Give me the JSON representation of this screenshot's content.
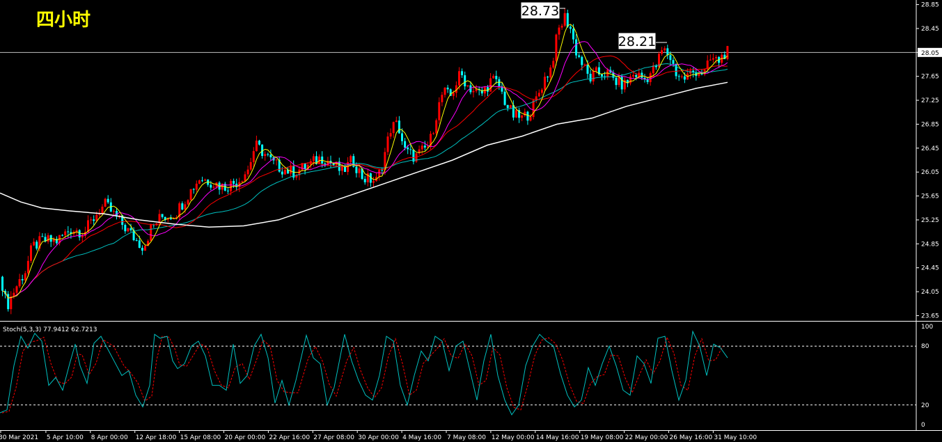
{
  "period_label": "四小时",
  "colors": {
    "background": "#000000",
    "bull_candle": "#ff0000",
    "bear_candle": "#00ffff",
    "ma_fast": "#ffff00",
    "ma_mid": "#ff00ff",
    "ma_slow": "#ff0000",
    "ma_long": "#00c0c0",
    "ma_200": "#ffffff",
    "stoch_main": "#00c0c0",
    "stoch_signal": "#ff0000",
    "axis_text": "#ffffff",
    "level_line": "#ffffff"
  },
  "annotations": {
    "high_label": "28.73",
    "second_high_label": "28.21"
  },
  "stoch": {
    "label": "Stoch(5,3,3) 77.9412 62.7213",
    "level_high": 80,
    "level_low": 20,
    "ticks": [
      "100",
      "80",
      "20",
      "0"
    ]
  },
  "chart_data": {
    "type": "candlestick",
    "price_axis": {
      "ticks": [
        "28.85",
        "28.45",
        "28.05",
        "27.65",
        "27.25",
        "26.85",
        "26.45",
        "26.05",
        "25.65",
        "25.25",
        "24.85",
        "24.45",
        "24.05",
        "23.65"
      ],
      "range": [
        23.62,
        28.88
      ],
      "current_price": "28.05"
    },
    "time_axis": [
      "30 Mar 2021",
      "5 Apr 10:00",
      "8 Apr 00:00",
      "12 Apr 18:00",
      "15 Apr 08:00",
      "20 Apr 00:00",
      "22 Apr 16:00",
      "27 Apr 08:00",
      "30 Apr 00:00",
      "4 May 16:00",
      "7 May 08:00",
      "12 May 00:00",
      "14 May 16:00",
      "19 May 08:00",
      "22 May 00:00",
      "26 May 16:00",
      "31 May 10:00"
    ],
    "close_path": [
      [
        0,
        24.3
      ],
      [
        8,
        23.8
      ],
      [
        20,
        24.1
      ],
      [
        35,
        24.4
      ],
      [
        45,
        24.8
      ],
      [
        60,
        24.9
      ],
      [
        80,
        24.9
      ],
      [
        100,
        25.1
      ],
      [
        120,
        25.05
      ],
      [
        140,
        25.4
      ],
      [
        150,
        25.5
      ],
      [
        165,
        25.3
      ],
      [
        180,
        25.1
      ],
      [
        195,
        24.9
      ],
      [
        205,
        24.8
      ],
      [
        215,
        25.1
      ],
      [
        230,
        25.3
      ],
      [
        250,
        25.35
      ],
      [
        270,
        25.7
      ],
      [
        285,
        25.95
      ],
      [
        300,
        25.9
      ],
      [
        320,
        25.8
      ],
      [
        340,
        25.9
      ],
      [
        355,
        26.1
      ],
      [
        365,
        26.5
      ],
      [
        375,
        26.4
      ],
      [
        390,
        26.2
      ],
      [
        405,
        26.1
      ],
      [
        420,
        26.05
      ],
      [
        440,
        26.15
      ],
      [
        460,
        26.3
      ],
      [
        475,
        26.2
      ],
      [
        490,
        26.05
      ],
      [
        505,
        26.25
      ],
      [
        520,
        25.95
      ],
      [
        540,
        25.9
      ],
      [
        550,
        26.3
      ],
      [
        560,
        26.8
      ],
      [
        570,
        26.85
      ],
      [
        580,
        26.4
      ],
      [
        595,
        26.3
      ],
      [
        605,
        26.4
      ],
      [
        615,
        26.5
      ],
      [
        625,
        27.0
      ],
      [
        635,
        27.4
      ],
      [
        645,
        27.3
      ],
      [
        660,
        27.7
      ],
      [
        670,
        27.5
      ],
      [
        680,
        27.4
      ],
      [
        690,
        27.35
      ],
      [
        705,
        27.6
      ],
      [
        715,
        27.5
      ],
      [
        725,
        27.2
      ],
      [
        735,
        27.0
      ],
      [
        748,
        26.95
      ],
      [
        760,
        27.05
      ],
      [
        770,
        27.3
      ],
      [
        780,
        27.6
      ],
      [
        790,
        27.8
      ],
      [
        800,
        28.4
      ],
      [
        810,
        28.65
      ],
      [
        818,
        28.45
      ],
      [
        825,
        28.1
      ],
      [
        835,
        27.85
      ],
      [
        845,
        27.6
      ],
      [
        855,
        27.7
      ],
      [
        870,
        27.7
      ],
      [
        885,
        27.55
      ],
      [
        895,
        27.5
      ],
      [
        910,
        27.7
      ],
      [
        925,
        27.6
      ],
      [
        940,
        27.8
      ],
      [
        950,
        28.1
      ],
      [
        960,
        28.0
      ],
      [
        970,
        27.7
      ],
      [
        980,
        27.6
      ],
      [
        990,
        27.7
      ],
      [
        1000,
        27.75
      ],
      [
        1010,
        27.7
      ],
      [
        1020,
        27.95
      ],
      [
        1030,
        27.9
      ],
      [
        1040,
        28.05
      ]
    ],
    "ma_200": [
      [
        0,
        25.7
      ],
      [
        30,
        25.55
      ],
      [
        60,
        25.45
      ],
      [
        100,
        25.4
      ],
      [
        150,
        25.35
      ],
      [
        200,
        25.25
      ],
      [
        250,
        25.18
      ],
      [
        300,
        25.13
      ],
      [
        350,
        25.15
      ],
      [
        400,
        25.25
      ],
      [
        450,
        25.45
      ],
      [
        500,
        25.65
      ],
      [
        550,
        25.85
      ],
      [
        600,
        26.05
      ],
      [
        650,
        26.25
      ],
      [
        700,
        26.5
      ],
      [
        750,
        26.65
      ],
      [
        800,
        26.85
      ],
      [
        850,
        26.95
      ],
      [
        900,
        27.15
      ],
      [
        950,
        27.3
      ],
      [
        1000,
        27.45
      ],
      [
        1045,
        27.55
      ]
    ],
    "stoch_path": [
      [
        0,
        12
      ],
      [
        10,
        15
      ],
      [
        20,
        60
      ],
      [
        30,
        90
      ],
      [
        40,
        78
      ],
      [
        50,
        93
      ],
      [
        60,
        85
      ],
      [
        70,
        40
      ],
      [
        80,
        48
      ],
      [
        90,
        35
      ],
      [
        100,
        62
      ],
      [
        108,
        82
      ],
      [
        115,
        60
      ],
      [
        125,
        42
      ],
      [
        135,
        83
      ],
      [
        145,
        90
      ],
      [
        160,
        70
      ],
      [
        175,
        50
      ],
      [
        185,
        55
      ],
      [
        195,
        30
      ],
      [
        205,
        18
      ],
      [
        215,
        40
      ],
      [
        222,
        92
      ],
      [
        230,
        88
      ],
      [
        240,
        90
      ],
      [
        248,
        65
      ],
      [
        255,
        57
      ],
      [
        265,
        62
      ],
      [
        275,
        80
      ],
      [
        285,
        85
      ],
      [
        295,
        70
      ],
      [
        305,
        40
      ],
      [
        315,
        40
      ],
      [
        325,
        35
      ],
      [
        335,
        82
      ],
      [
        345,
        42
      ],
      [
        355,
        50
      ],
      [
        365,
        80
      ],
      [
        375,
        92
      ],
      [
        385,
        68
      ],
      [
        395,
        22
      ],
      [
        405,
        45
      ],
      [
        415,
        20
      ],
      [
        425,
        45
      ],
      [
        440,
        91
      ],
      [
        450,
        68
      ],
      [
        460,
        62
      ],
      [
        470,
        20
      ],
      [
        480,
        38
      ],
      [
        495,
        92
      ],
      [
        505,
        65
      ],
      [
        515,
        45
      ],
      [
        525,
        30
      ],
      [
        535,
        25
      ],
      [
        545,
        50
      ],
      [
        555,
        90
      ],
      [
        565,
        85
      ],
      [
        575,
        40
      ],
      [
        585,
        20
      ],
      [
        595,
        50
      ],
      [
        605,
        75
      ],
      [
        615,
        65
      ],
      [
        625,
        90
      ],
      [
        635,
        85
      ],
      [
        645,
        55
      ],
      [
        655,
        80
      ],
      [
        665,
        85
      ],
      [
        675,
        55
      ],
      [
        685,
        25
      ],
      [
        695,
        65
      ],
      [
        705,
        92
      ],
      [
        715,
        50
      ],
      [
        725,
        25
      ],
      [
        735,
        10
      ],
      [
        745,
        20
      ],
      [
        755,
        60
      ],
      [
        765,
        80
      ],
      [
        775,
        92
      ],
      [
        785,
        85
      ],
      [
        795,
        80
      ],
      [
        805,
        52
      ],
      [
        815,
        30
      ],
      [
        825,
        18
      ],
      [
        835,
        25
      ],
      [
        845,
        58
      ],
      [
        855,
        40
      ],
      [
        865,
        62
      ],
      [
        875,
        80
      ],
      [
        885,
        60
      ],
      [
        895,
        35
      ],
      [
        905,
        30
      ],
      [
        915,
        70
      ],
      [
        925,
        62
      ],
      [
        935,
        42
      ],
      [
        945,
        88
      ],
      [
        955,
        90
      ],
      [
        965,
        55
      ],
      [
        975,
        25
      ],
      [
        985,
        45
      ],
      [
        995,
        95
      ],
      [
        1005,
        80
      ],
      [
        1015,
        50
      ],
      [
        1025,
        82
      ],
      [
        1035,
        78
      ],
      [
        1045,
        68
      ]
    ]
  }
}
